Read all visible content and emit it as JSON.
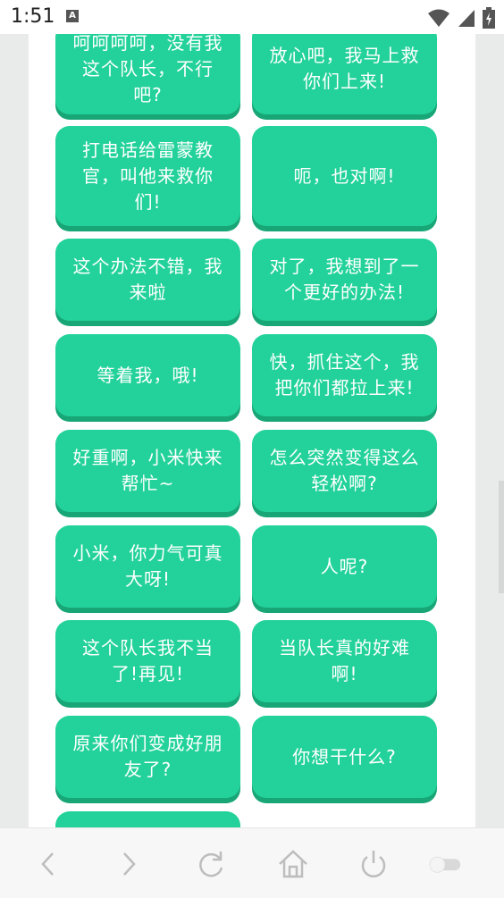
{
  "status_bar": {
    "time": "1:51",
    "notification_icon": "A"
  },
  "cards": [
    {
      "text": "呵呵呵呵，没有我这个队长，不行吧?"
    },
    {
      "text": "放心吧，我马上救你们上来!"
    },
    {
      "text": "打电话给雷蒙教官，叫他来救你们!"
    },
    {
      "text": "呃，也对啊!"
    },
    {
      "text": "这个办法不错，我来啦"
    },
    {
      "text": "对了，我想到了一个更好的办法!"
    },
    {
      "text": "等着我，哦!"
    },
    {
      "text": "快，抓住这个，我把你们都拉上来!"
    },
    {
      "text": "好重啊，小米快来帮忙~"
    },
    {
      "text": "怎么突然变得这么轻松啊?"
    },
    {
      "text": "小米，你力气可真大呀!"
    },
    {
      "text": "人呢?"
    },
    {
      "text": "这个队长我不当了!再见!"
    },
    {
      "text": "当队长真的好难啊!"
    },
    {
      "text": "原来你们变成好朋友了?"
    },
    {
      "text": "你想干什么?"
    },
    {
      "text": ""
    }
  ],
  "colors": {
    "card": "#23d29a",
    "card_shadow": "#18a677"
  },
  "nav": {
    "icons": [
      "back-icon",
      "forward-icon",
      "reload-icon",
      "home-icon",
      "power-icon",
      "toggle-icon"
    ]
  }
}
